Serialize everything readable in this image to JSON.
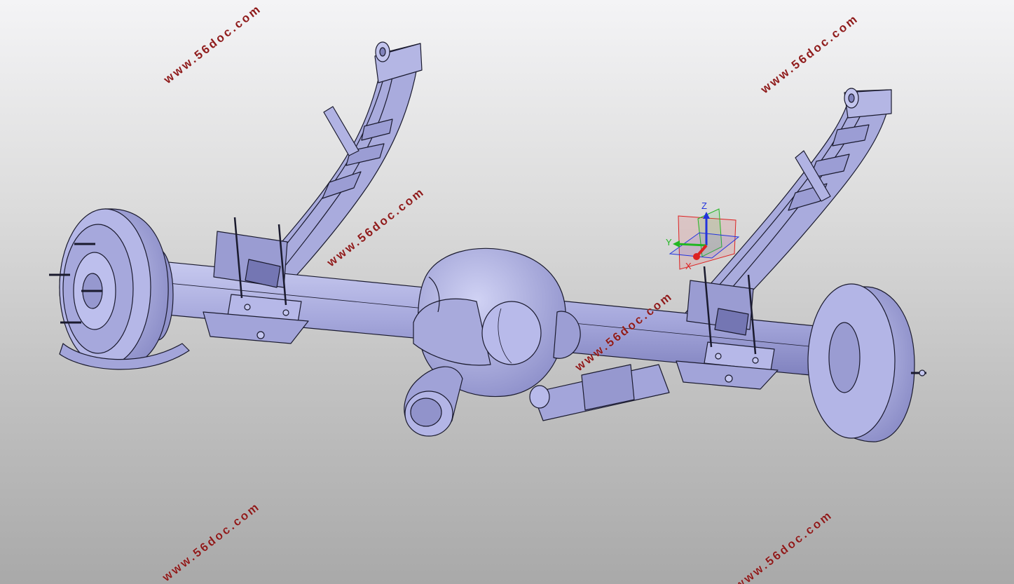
{
  "watermarks": [
    "www.56doc.com",
    "www.56doc.com",
    "www.56doc.com",
    "www.56doc.com",
    "www.56doc.com",
    "www.56doc.com"
  ],
  "triad": {
    "x_label": "X",
    "y_label": "Y",
    "z_label": "Z"
  },
  "colors": {
    "part_fill": "#a7a9dc",
    "part_edge": "#1a1a2e",
    "watermark": "#8e1a1a",
    "x_axis": "#d22",
    "y_axis": "#22b622",
    "z_axis": "#2233dd"
  }
}
